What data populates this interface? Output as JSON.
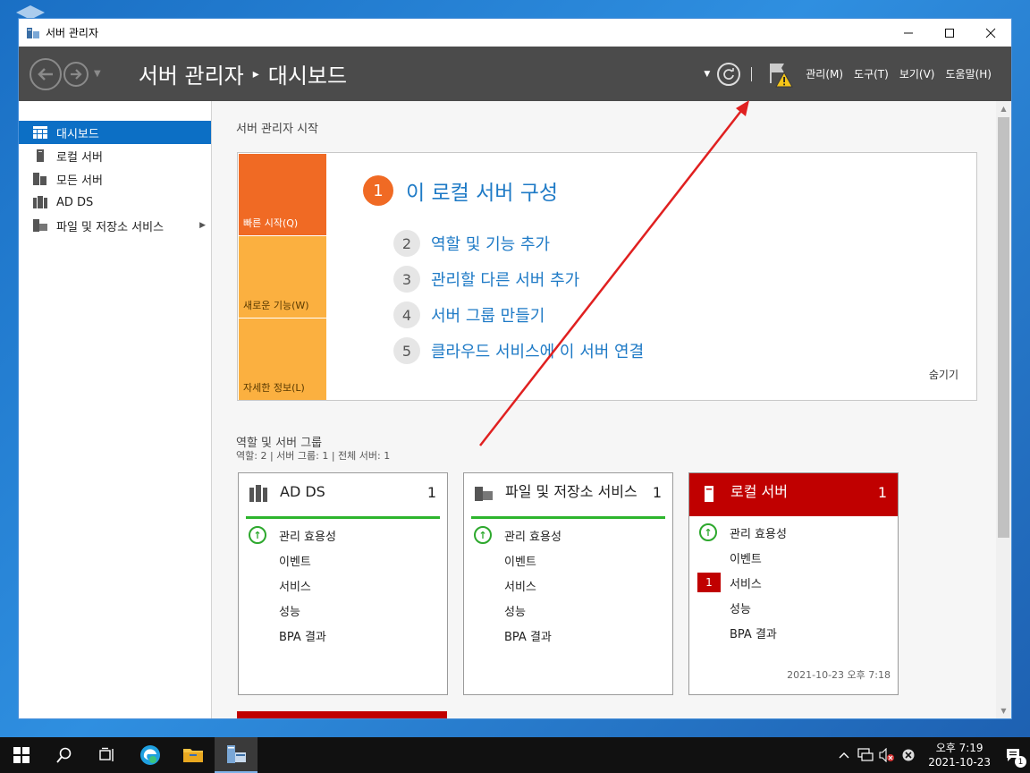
{
  "window": {
    "title": "서버 관리자"
  },
  "header": {
    "breadcrumb_root": "서버 관리자",
    "breadcrumb_separator": "▸",
    "breadcrumb_current": "대시보드",
    "menus": [
      "관리(M)",
      "도구(T)",
      "보기(V)",
      "도움말(H)"
    ]
  },
  "sidebar": {
    "items": [
      {
        "label": "대시보드",
        "icon": "dashboard-icon",
        "active": true
      },
      {
        "label": "로컬 서버",
        "icon": "server-icon"
      },
      {
        "label": "모든 서버",
        "icon": "servers-icon"
      },
      {
        "label": "AD DS",
        "icon": "ad-ds-icon"
      },
      {
        "label": "파일 및 저장소 서비스",
        "icon": "file-storage-icon",
        "expandable": true
      }
    ]
  },
  "welcome": {
    "title": "서버 관리자 시작",
    "tabs": [
      "빠른 시작(Q)",
      "새로운 기능(W)",
      "자세한 정보(L)"
    ],
    "main_step": {
      "number": "1",
      "label": "이 로컬 서버 구성"
    },
    "steps": [
      {
        "number": "2",
        "label": "역할 및 기능 추가"
      },
      {
        "number": "3",
        "label": "관리할 다른 서버 추가"
      },
      {
        "number": "4",
        "label": "서버 그룹 만들기"
      },
      {
        "number": "5",
        "label": "클라우드 서비스에 이 서버 연결"
      }
    ],
    "hide_label": "숨기기"
  },
  "roles": {
    "title": "역할 및 서버 그룹",
    "summary": "역할: 2   |   서버 그룹: 1   |   전체 서버: 1",
    "tiles": [
      {
        "name": "AD DS",
        "count": "1",
        "status": "normal",
        "rows": [
          "관리 효용성",
          "이벤트",
          "서비스",
          "성능",
          "BPA 결과"
        ]
      },
      {
        "name": "파일 및 저장소 서비스",
        "count": "1",
        "status": "normal",
        "rows": [
          "관리 효용성",
          "이벤트",
          "서비스",
          "성능",
          "BPA 결과"
        ]
      },
      {
        "name": "로컬 서버",
        "count": "1",
        "status": "alert",
        "rows": [
          "관리 효용성",
          "이벤트",
          "서비스",
          "성능",
          "BPA 결과"
        ],
        "service_alert_count": "1",
        "timestamp": "2021-10-23 오후 7:18"
      }
    ]
  },
  "taskbar": {
    "time": "오후 7:19",
    "date": "2021-10-23",
    "notification_count": "1"
  },
  "colors": {
    "accent_blue": "#0c6fc5",
    "link_blue": "#1e7ac6",
    "quickstart_orange": "#f06a24",
    "tab_yellow": "#fbb040",
    "alert_red": "#c00000",
    "ok_green": "#2db52d",
    "header_gray": "#4b4b4b",
    "annotation_arrow": "#e02020"
  }
}
